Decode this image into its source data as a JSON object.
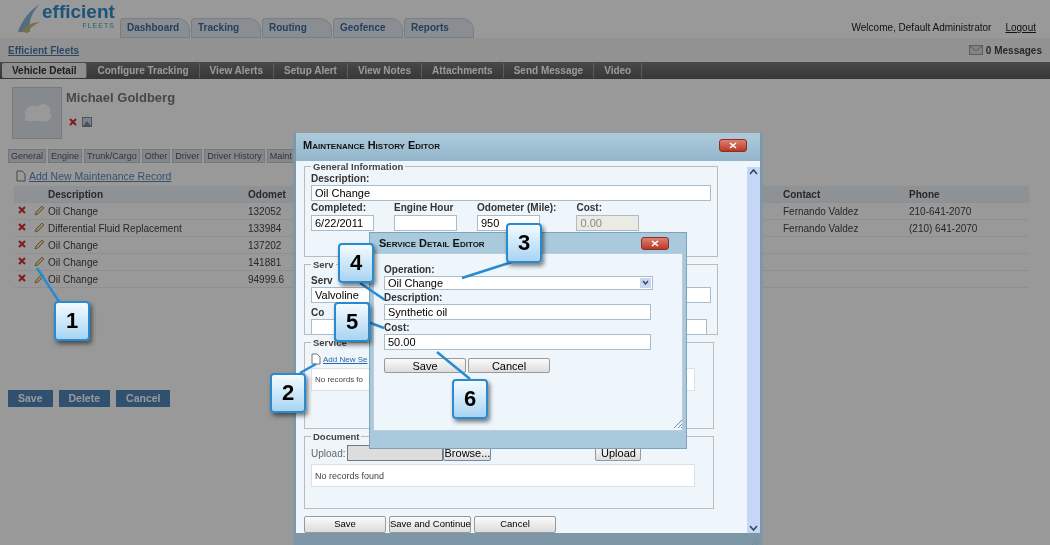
{
  "header": {
    "logo_word": "efficient",
    "logo_tagline": "FLEETS",
    "nav_tabs": [
      "Dashboard",
      "Tracking",
      "Routing",
      "Geofence",
      "Reports"
    ],
    "welcome": "Welcome, Default Administrator",
    "logout": "Logout"
  },
  "breadcrumb": "Efficient Fleets",
  "messages": "0 Messages",
  "sub_tabs": [
    {
      "label": "Vehicle Detail",
      "selected": true
    },
    {
      "label": "Configure Tracking",
      "selected": false
    },
    {
      "label": "View Alerts",
      "selected": false
    },
    {
      "label": "Setup Alert",
      "selected": false
    },
    {
      "label": "View Notes",
      "selected": false
    },
    {
      "label": "Attachments",
      "selected": false
    },
    {
      "label": "Send Message",
      "selected": false
    },
    {
      "label": "Video",
      "selected": false
    }
  ],
  "vehicle": {
    "name": "Michael Goldberg"
  },
  "detail_tabs": [
    "General",
    "Engine",
    "Trunk/Cargo",
    "Other",
    "Driver",
    "Driver History",
    "Maint"
  ],
  "maintenance": {
    "add_link": "Add New Maintenance Record",
    "columns": [
      "Description",
      "Odomet",
      "Contact",
      "Phone"
    ],
    "rows": [
      {
        "description": "Oil Change",
        "odometer": "132052",
        "contact": "Fernando Valdez",
        "phone": "210-641-2070"
      },
      {
        "description": "Differential Fluid Replacement",
        "odometer": "133984",
        "contact": "Fernando Valdez",
        "phone": "(210) 641-2070"
      },
      {
        "description": "Oil Change",
        "odometer": "137202"
      },
      {
        "description": "Oil Change",
        "odometer": "141881"
      },
      {
        "description": "Oil Change",
        "odometer": "94999.6"
      }
    ]
  },
  "buttons": [
    "Save",
    "Delete",
    "Cancel"
  ],
  "history_editor": {
    "title": "Maintenance History Editor",
    "general": {
      "legend": "General Information",
      "description_label": "Description:",
      "description": "Oil Change",
      "fields": [
        {
          "label": "Completed:",
          "value": "6/22/2011",
          "disabled": false
        },
        {
          "label": "Engine Hour",
          "disabled": false
        },
        {
          "label": "Odometer (Mile):",
          "value": "950",
          "disabled": false
        },
        {
          "label": "Cost:",
          "value": "0.00",
          "disabled": true
        }
      ]
    },
    "provider": {
      "legend": "Serv",
      "label_1": "Serv",
      "value_1": "Valvoline",
      "label_2": "Co"
    },
    "service": {
      "legend": "Service",
      "add_link": "Add New Se",
      "empty": "No records fo"
    },
    "document": {
      "legend": "Document",
      "upload_label": "Upload:",
      "browse": "Browse...",
      "upload": "Upload",
      "empty": "No records found"
    },
    "buttons": [
      "Save",
      "Save and Continue",
      "Cancel"
    ]
  },
  "service_editor": {
    "title": "Service Detail Editor",
    "operation_label": "Operation:",
    "operation": "Oil Change",
    "description_label": "Description:",
    "description": "Synthetic oil",
    "cost_label": "Cost:",
    "cost": "50.00",
    "buttons": [
      "Save",
      "Cancel"
    ]
  },
  "callouts": [
    "1",
    "2",
    "3",
    "4",
    "5",
    "6"
  ]
}
